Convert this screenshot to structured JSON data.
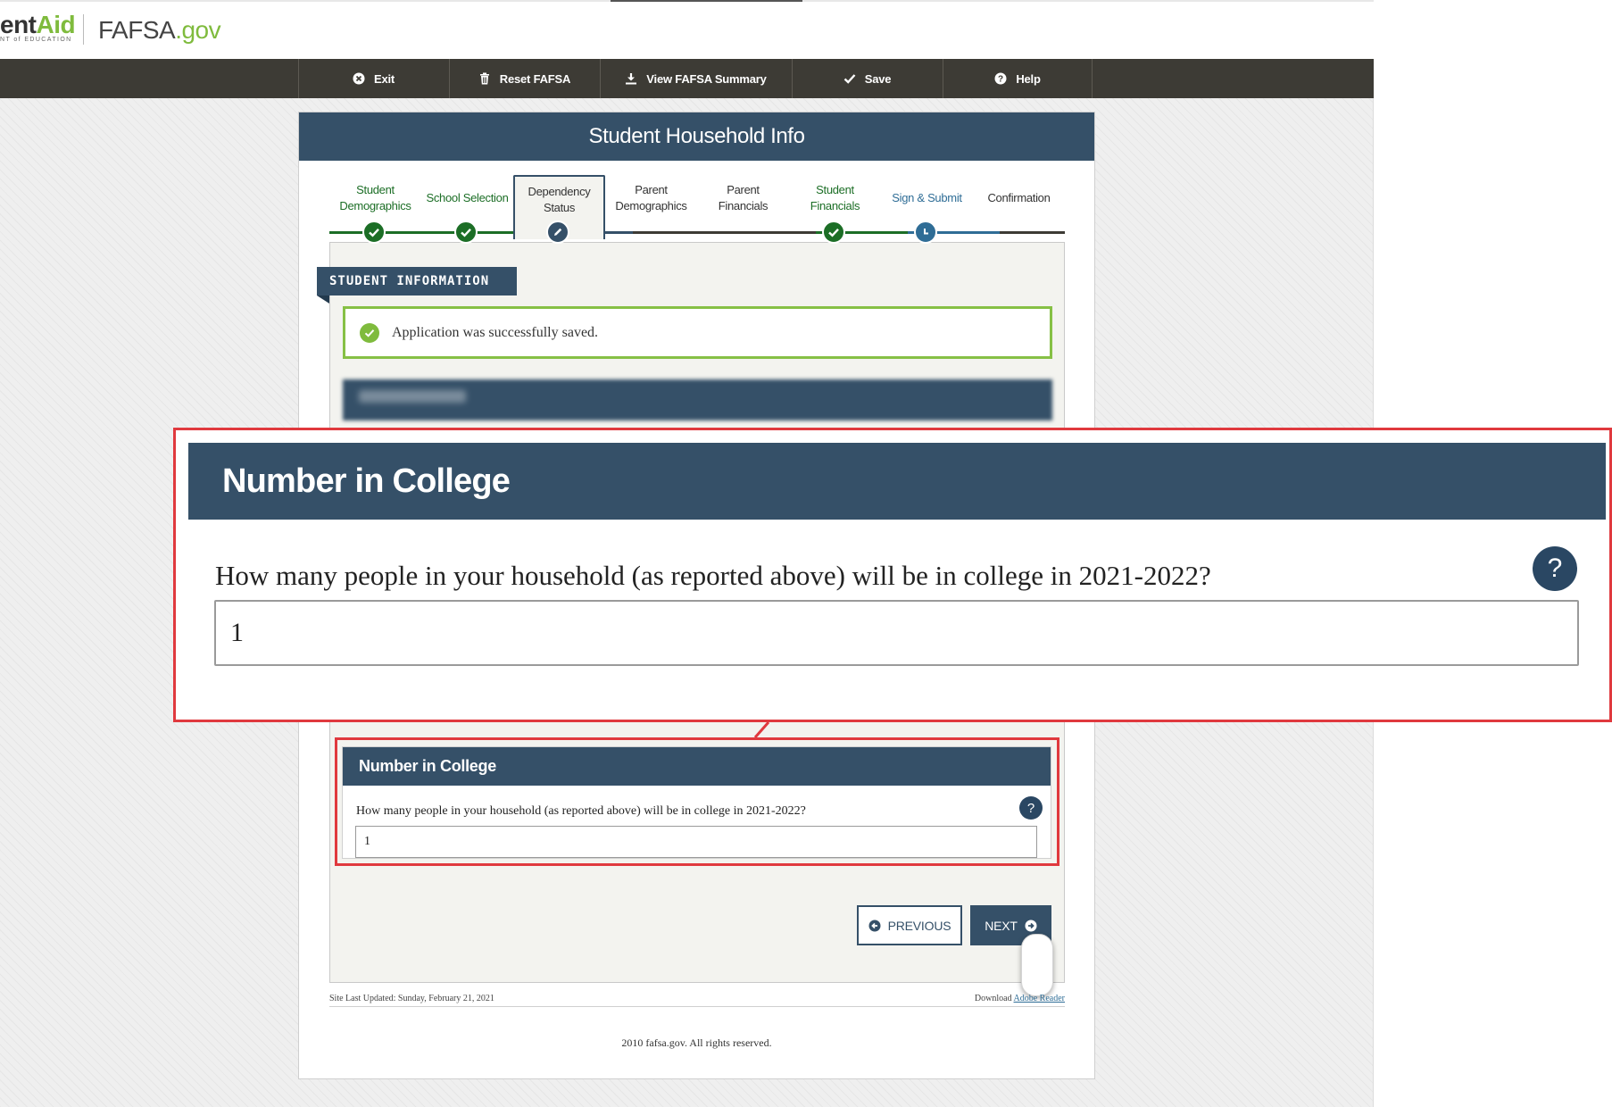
{
  "header": {
    "fsa_logo_main": "ent",
    "fsa_logo_accent": "Aid",
    "fsa_logo_sub": "NT of EDUCATION",
    "fafsa_logo_main": "FAFSA",
    "fafsa_logo_accent": ".gov"
  },
  "toolbar": {
    "items": [
      {
        "label": "Exit",
        "icon": "exit-circle-icon"
      },
      {
        "label": "Reset FAFSA",
        "icon": "trash-icon"
      },
      {
        "label": "View FAFSA Summary",
        "icon": "download-icon"
      },
      {
        "label": "Save",
        "icon": "checkmark-icon"
      },
      {
        "label": "Help",
        "icon": "question-circle-icon"
      }
    ]
  },
  "card": {
    "title": "Student Household Info"
  },
  "steps": [
    {
      "label_line1": "Student",
      "label_line2": "Demographics",
      "state": "done"
    },
    {
      "label_line1": "School Selection",
      "label_line2": "",
      "state": "done"
    },
    {
      "label_line1": "Dependency",
      "label_line2": "Status",
      "state": "active"
    },
    {
      "label_line1": "Parent",
      "label_line2": "Demographics",
      "state": "pending"
    },
    {
      "label_line1": "Parent",
      "label_line2": "Financials",
      "state": "pending"
    },
    {
      "label_line1": "Student",
      "label_line2": "Financials",
      "state": "done"
    },
    {
      "label_line1": "Sign & Submit",
      "label_line2": "",
      "state": "signing"
    },
    {
      "label_line1": "Confirmation",
      "label_line2": "",
      "state": "pending"
    }
  ],
  "section_tag": "STUDENT INFORMATION",
  "alert": {
    "message": "Application was successfully saved."
  },
  "number_in_college": {
    "heading": "Number in College",
    "question": "How many people in your household (as reported above) will be in college in 2021-2022?",
    "help_label": "?",
    "value": "1"
  },
  "nav": {
    "previous_label": "PREVIOUS",
    "next_label": "NEXT"
  },
  "footer": {
    "updated": "Site Last Updated: Sunday, February 21, 2021",
    "download_prefix": "Download ",
    "download_link": "Adobe Reader",
    "copyright": "2010 fafsa.gov. All rights reserved."
  },
  "colors": {
    "navy": "#355068",
    "toolbar": "#3d3b35",
    "success_green": "#7fbb3d",
    "step_green": "#1c6e26",
    "highlight_red": "#e0393e"
  }
}
